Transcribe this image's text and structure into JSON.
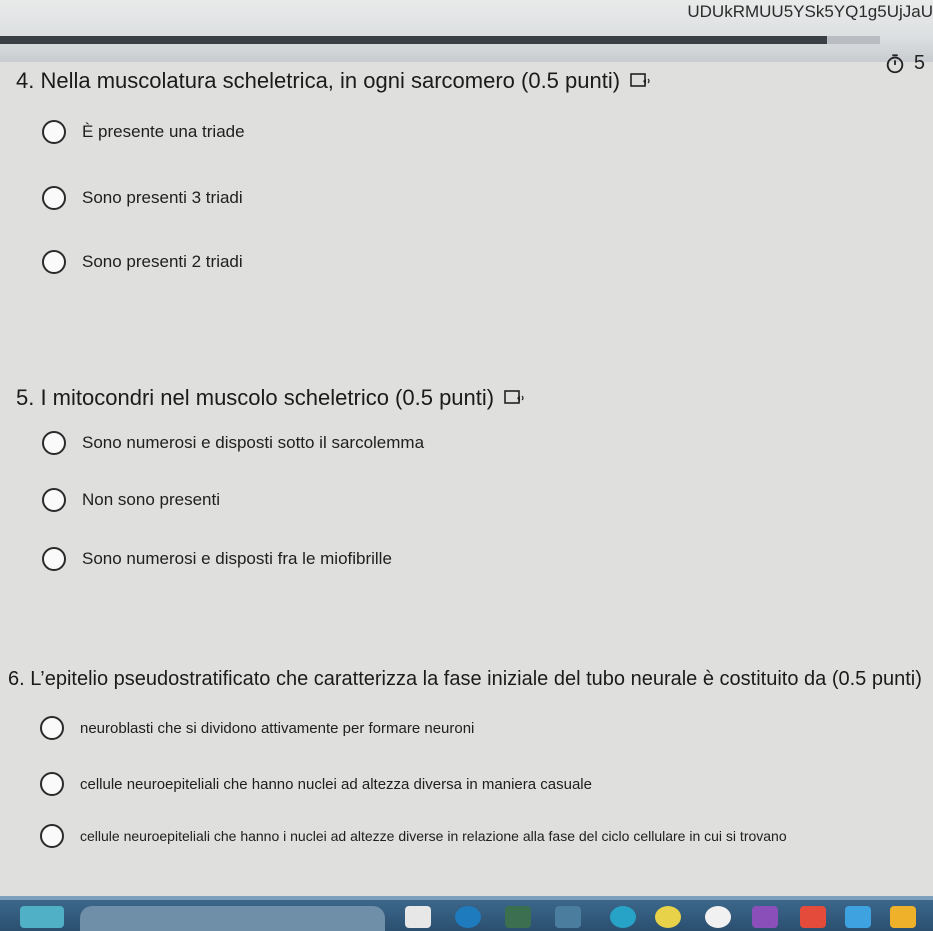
{
  "browser": {
    "url_fragment": "UDUkRMUU5YSk5YQ1g5UjJaU",
    "progress_fraction": 0.94
  },
  "timer": {
    "icon": "stopwatch-icon",
    "value": "5"
  },
  "questions": [
    {
      "title": "4. Nella muscolatura scheletrica, in ogni sarcomero (0.5 punti)",
      "options": [
        "È presente una triade",
        "Sono presenti 3 triadi",
        "Sono presenti 2 triadi"
      ]
    },
    {
      "title": "5. I mitocondri nel muscolo scheletrico (0.5 punti)",
      "options": [
        "Sono numerosi e disposti sotto il sarcolemma",
        "Non sono presenti",
        "Sono numerosi e disposti fra le miofibrille"
      ]
    },
    {
      "title": "6. L’epitelio pseudostratificato che caratterizza la fase iniziale del tubo neurale è costituito da  (0.5 punti)",
      "options": [
        "neuroblasti che si dividono attivamente per formare neuroni",
        "cellule neuroepiteliali che hanno nuclei ad altezza diversa in maniera casuale",
        "cellule neuroepiteliali che hanno i nuclei ad altezze diverse in relazione alla fase del ciclo cellulare in cui si trovano"
      ]
    }
  ],
  "colors": {
    "taskbar": "#2b4f6f",
    "background": "#dfdfdd"
  }
}
